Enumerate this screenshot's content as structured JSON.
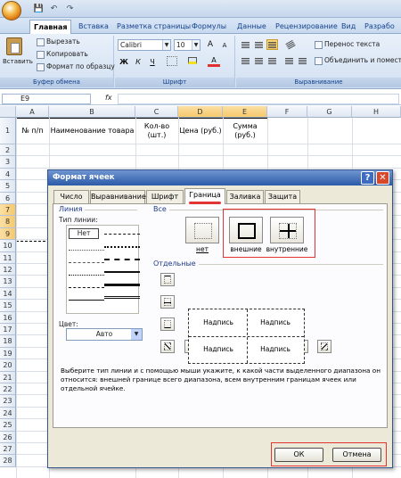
{
  "qat": {
    "save": "💾",
    "undo": "↶",
    "redo": "↷"
  },
  "ribbon": {
    "tabs": [
      "Главная",
      "Вставка",
      "Разметка страницы",
      "Формулы",
      "Данные",
      "Рецензирование",
      "Вид",
      "Разрабо"
    ],
    "active_tab": "Главная",
    "clipboard": {
      "paste": "Вставить",
      "cut": "Вырезать",
      "copy": "Копировать",
      "format_painter": "Формат по образцу",
      "label": "Буфер обмена"
    },
    "font": {
      "name": "Calibri",
      "size": "10",
      "bold": "Ж",
      "italic": "К",
      "underline": "Ч",
      "grow": "A",
      "shrink": "A",
      "color_letter": "A",
      "label": "Шрифт"
    },
    "alignment": {
      "wrap": "Перенос текста",
      "merge": "Объединить и поместит",
      "label": "Выравнивание"
    }
  },
  "formula_bar": {
    "cell_ref": "E9",
    "fx": "fx"
  },
  "sheet": {
    "columns": [
      "A",
      "B",
      "C",
      "D",
      "E",
      "F",
      "G",
      "H"
    ],
    "rows": [
      "1",
      "2",
      "3",
      "4",
      "5",
      "6",
      "7",
      "8",
      "9",
      "10",
      "11",
      "12",
      "13",
      "14",
      "15",
      "16",
      "17",
      "18",
      "19",
      "20",
      "21",
      "22",
      "23",
      "24",
      "25",
      "26",
      "27",
      "28"
    ],
    "header_cells": {
      "a": "№ п/п",
      "b": "Наименование товара",
      "c": "Кол-во (шт.)",
      "d": "Цена (руб.)",
      "e": "Сумма (руб.)"
    }
  },
  "dialog": {
    "title": "Формат ячеек",
    "help": "?",
    "close": "✕",
    "tabs": [
      "Число",
      "Выравнивание",
      "Шрифт",
      "Граница",
      "Заливка",
      "Защита"
    ],
    "active_tab": "Граница",
    "line_group": "Линия",
    "line_type_label": "Тип линии:",
    "line_none": "Нет",
    "color_label": "Цвет:",
    "color_value": "Авто",
    "presets_group": "Все",
    "preset_none": "нет",
    "preset_outline": "внешние",
    "preset_inside": "внутренние",
    "individual_group": "Отдельные",
    "preview_text": "Надпись",
    "hint": "Выберите тип линии и с помощью мыши укажите, к какой части выделенного диапазона он относится: внешней границе всего диапазона, всем внутренним границам ячеек или отдельной ячейке.",
    "ok": "ОК",
    "cancel": "Отмена"
  },
  "colors": {
    "highlight": "#e33434",
    "title_bar": "#2c5aa8",
    "selected_header": "#f5c86c"
  }
}
